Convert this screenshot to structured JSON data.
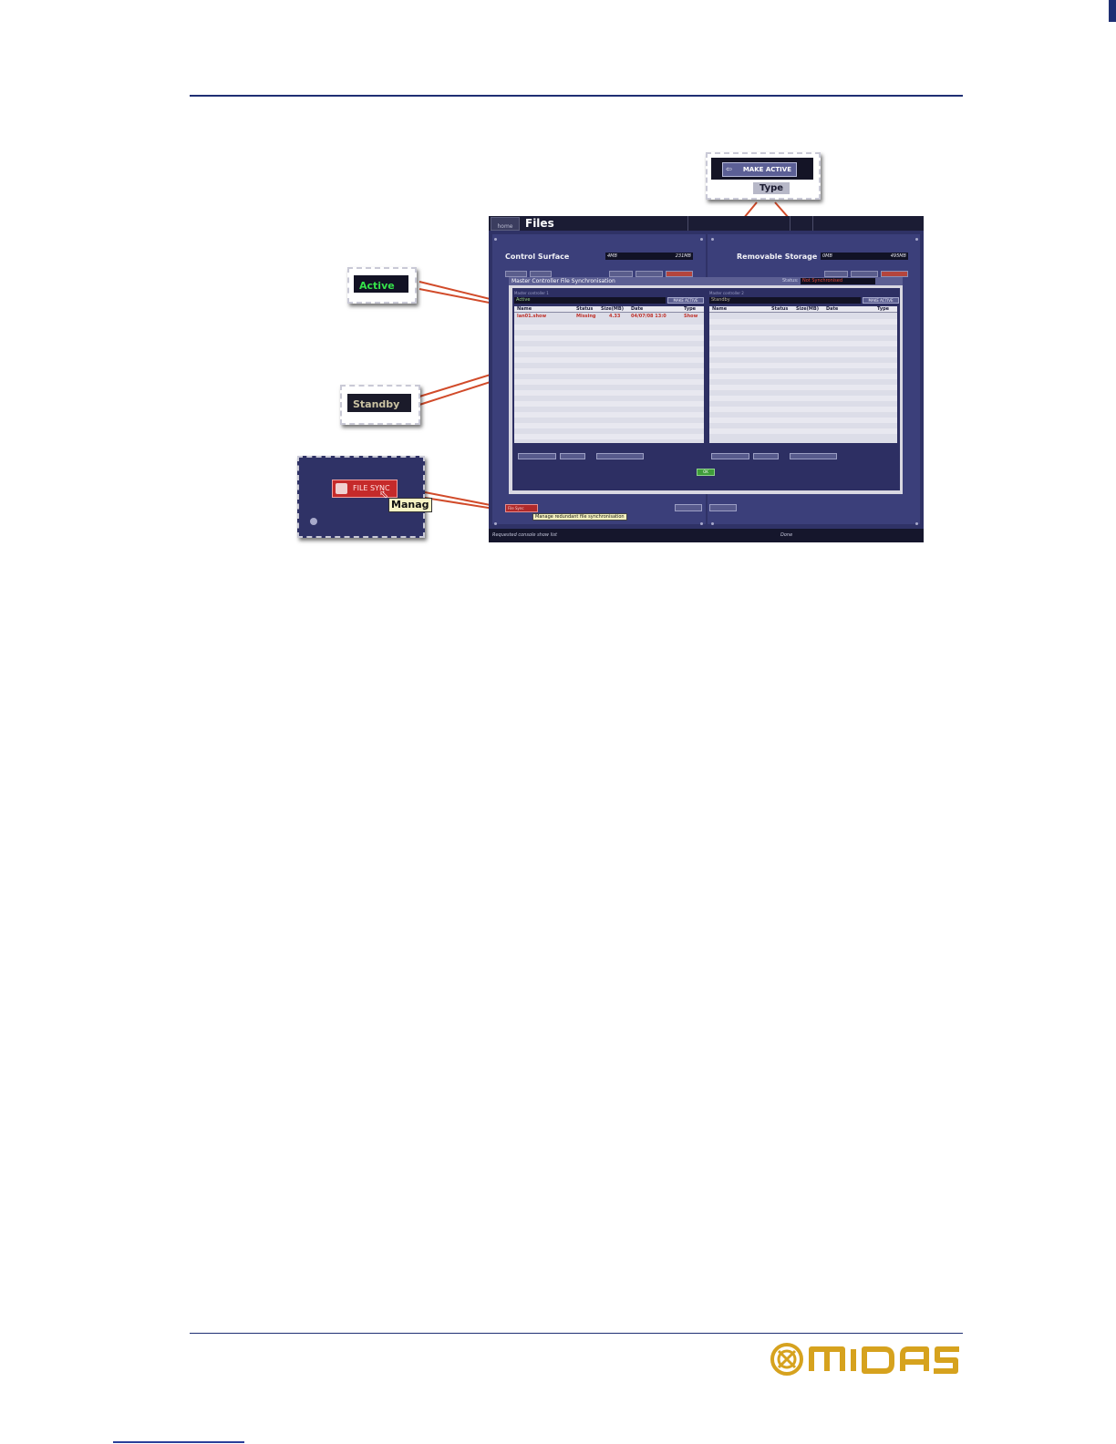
{
  "screen": {
    "home_tab": "home",
    "title": "Files",
    "control_surface": {
      "label": "Control Surface",
      "meter_left": "4MB",
      "meter_right": "231MB"
    },
    "removable_storage": {
      "label": "Removable Storage",
      "meter_left": "0MB",
      "meter_right": "495MB"
    },
    "dialog": {
      "title": "Master Controller File Synchronisation",
      "status_label": "Status:",
      "status_value": "Not Synchronised",
      "mc1": {
        "label": "Master controller 1",
        "state": "Active",
        "button": "MAKE ACTIVE"
      },
      "mc2": {
        "label": "Master controller 2",
        "state": "Standby",
        "button": "MAKE ACTIVE"
      },
      "columns": [
        "Name",
        "Status",
        "Size(MB)",
        "Date",
        "Type"
      ],
      "rows_mc1": [
        {
          "name": "lan01.show",
          "status": "Missing",
          "size": "4.33",
          "date": "04/07/08 13:0",
          "type": "Show"
        }
      ],
      "ok_label": "OK"
    },
    "file_sync_button": "File Sync",
    "tooltip": "Manage redundant file synchronisation",
    "status_left": "Requested console show list",
    "status_right": "Done"
  },
  "callouts": {
    "make_active": {
      "button": "MAKE ACTIVE",
      "header": "Type"
    },
    "active": "Active",
    "standby": "Standby",
    "file_sync": {
      "button": "FILE SYNC",
      "tooltip_partial": "Manag"
    }
  },
  "colors": {
    "rule": "#1f2f73",
    "active_green": "#35e24a",
    "missing_red": "#c0322a",
    "midas_gold": "#d6a21e"
  },
  "footer": {
    "logo": "MIDAS"
  }
}
